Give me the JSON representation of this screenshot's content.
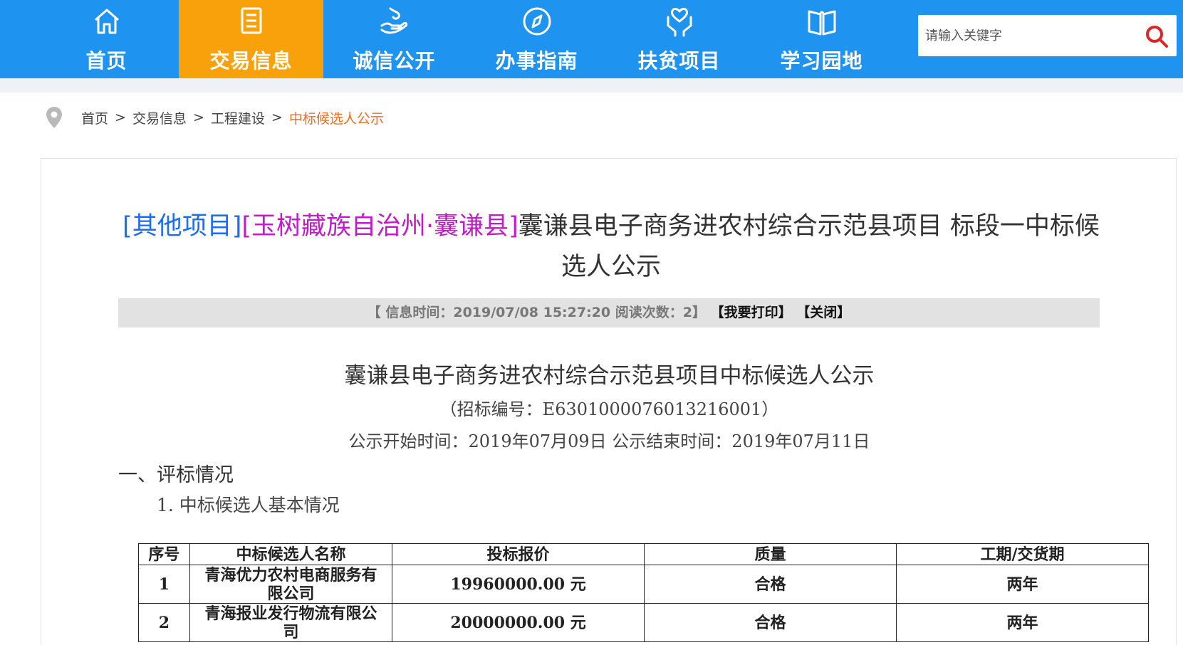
{
  "nav": {
    "items": [
      {
        "label": "首页",
        "icon": "home-icon"
      },
      {
        "label": "交易信息",
        "icon": "document-list-icon",
        "active": true
      },
      {
        "label": "诚信公开",
        "icon": "hand-care-icon"
      },
      {
        "label": "办事指南",
        "icon": "compass-icon"
      },
      {
        "label": "扶贫项目",
        "icon": "heart-hands-icon"
      },
      {
        "label": "学习园地",
        "icon": "book-icon"
      }
    ],
    "search_placeholder": "请输入关键字",
    "colors": {
      "bar": "#1e93f0",
      "active": "#f9a10b",
      "search_icon": "#e02323"
    }
  },
  "breadcrumb": {
    "items": [
      "首页",
      "交易信息",
      "工程建设"
    ],
    "current": "中标候选人公示",
    "separator": ">"
  },
  "article": {
    "category": "[其他项目]",
    "region": "[玉树藏族自治州·囊谦县]",
    "title": "囊谦县电子商务进农村综合示范县项目 标段一中标候选人公示",
    "meta_info": "【 信息时间：2019/07/08 15:27:20  阅读次数：2】",
    "print_label": "【我要打印】",
    "close_label": "【关闭】",
    "doc_title": "囊谦县电子商务进农村综合示范县项目中标候选人公示",
    "doc_code": "（招标编号：E6301000076013216001）",
    "doc_dates": "公示开始时间：2019年07月09日  公示结束时间：2019年07月11日",
    "section_heading": "一、评标情况",
    "sub_heading": "1. 中标候选人基本情况"
  },
  "table": {
    "headers": [
      "序号",
      "中标候选人名称",
      "投标报价",
      "质量",
      "工期/交货期"
    ],
    "rows": [
      {
        "no": "1",
        "name": "青海优力农村电商服务有限公司",
        "price": "19960000.00 元",
        "quality": "合格",
        "period": "两年"
      },
      {
        "no": "2",
        "name": "青海报业发行物流有限公司",
        "price": "20000000.00 元",
        "quality": "合格",
        "period": "两年"
      }
    ]
  }
}
